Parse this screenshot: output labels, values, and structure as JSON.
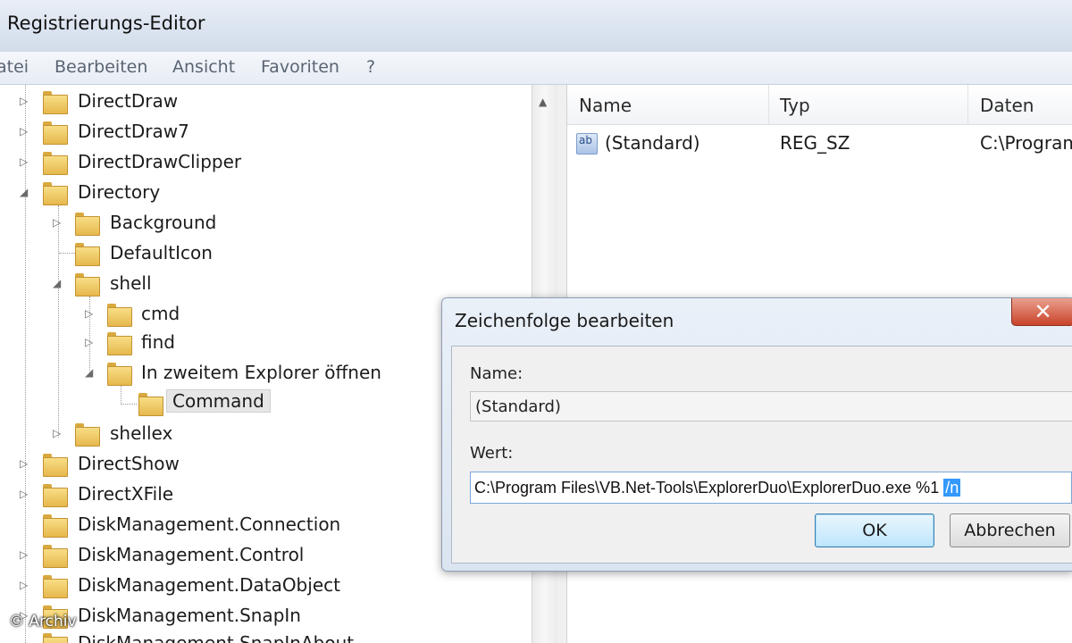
{
  "window": {
    "title": "Registrierungs-Editor"
  },
  "menu": [
    "atei",
    "Bearbeiten",
    "Ansicht",
    "Favoriten",
    "?"
  ],
  "tree": {
    "items": [
      {
        "label": "DirectDraw"
      },
      {
        "label": "DirectDraw7"
      },
      {
        "label": "DirectDrawClipper"
      },
      {
        "label": "Directory"
      },
      {
        "label": "Background"
      },
      {
        "label": "DefaultIcon"
      },
      {
        "label": "shell"
      },
      {
        "label": "cmd"
      },
      {
        "label": "find"
      },
      {
        "label": "In zweitem Explorer öffnen"
      },
      {
        "label": "Command"
      },
      {
        "label": "shellex"
      },
      {
        "label": "DirectShow"
      },
      {
        "label": "DirectXFile"
      },
      {
        "label": "DiskManagement.Connection"
      },
      {
        "label": "DiskManagement.Control"
      },
      {
        "label": "DiskManagement.DataObject"
      },
      {
        "label": "DiskManagement.SnapIn"
      },
      {
        "label": "DiskManagement.SnapInAbout"
      }
    ]
  },
  "list": {
    "columns": [
      "Name",
      "Typ",
      "Daten"
    ],
    "rows": [
      {
        "icon": "ab",
        "name": "(Standard)",
        "type": "REG_SZ",
        "data": "C:\\Program"
      }
    ]
  },
  "dialog": {
    "title": "Zeichenfolge bearbeiten",
    "close": "✕",
    "name_label": "Name:",
    "name_value": "(Standard)",
    "value_label": "Wert:",
    "value_text": "C:\\Program Files\\VB.Net-Tools\\ExplorerDuo\\ExplorerDuo.exe %1 ",
    "value_selected": "/n",
    "ok": "OK",
    "cancel": "Abbrechen"
  },
  "watermark": "© Archiv"
}
